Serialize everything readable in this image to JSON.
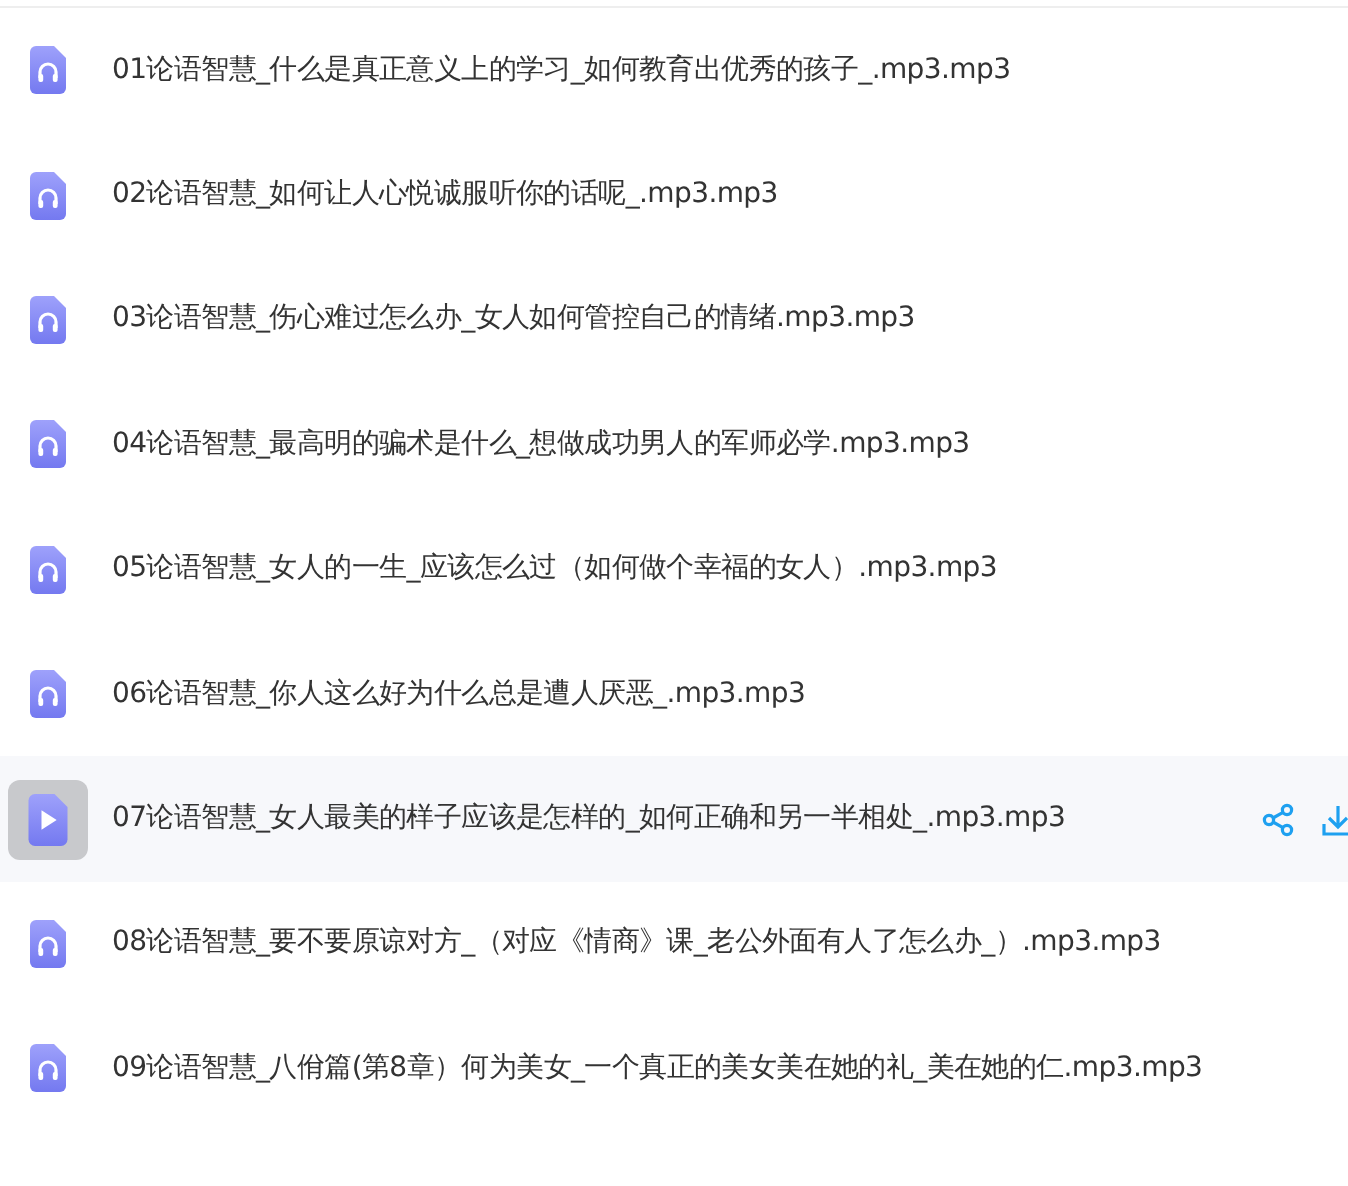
{
  "files": [
    {
      "name": "01论语智慧_什么是真正意义上的学习_如何教育出优秀的孩子_.mp3.mp3",
      "selected": false
    },
    {
      "name": "02论语智慧_如何让人心悦诚服听你的话呢_.mp3.mp3",
      "selected": false
    },
    {
      "name": "03论语智慧_伤心难过怎么办_女人如何管控自己的情绪.mp3.mp3",
      "selected": false
    },
    {
      "name": "04论语智慧_最高明的骗术是什么_想做成功男人的军师必学.mp3.mp3",
      "selected": false
    },
    {
      "name": "05论语智慧_女人的一生_应该怎么过（如何做个幸福的女人）.mp3.mp3",
      "selected": false
    },
    {
      "name": "06论语智慧_你人这么好为什么总是遭人厌恶_.mp3.mp3",
      "selected": false
    },
    {
      "name": "07论语智慧_女人最美的样子应该是怎样的_如何正确和另一半相处_.mp3.mp3",
      "selected": true
    },
    {
      "name": "08论语智慧_要不要原谅对方_（对应《情商》课_老公外面有人了怎么办_）.mp3.mp3",
      "selected": false
    },
    {
      "name": "09论语智慧_八佾篇(第8章）何为美女_一个真正的美女美在她的礼_美在她的仁.mp3.mp3",
      "selected": false
    }
  ]
}
